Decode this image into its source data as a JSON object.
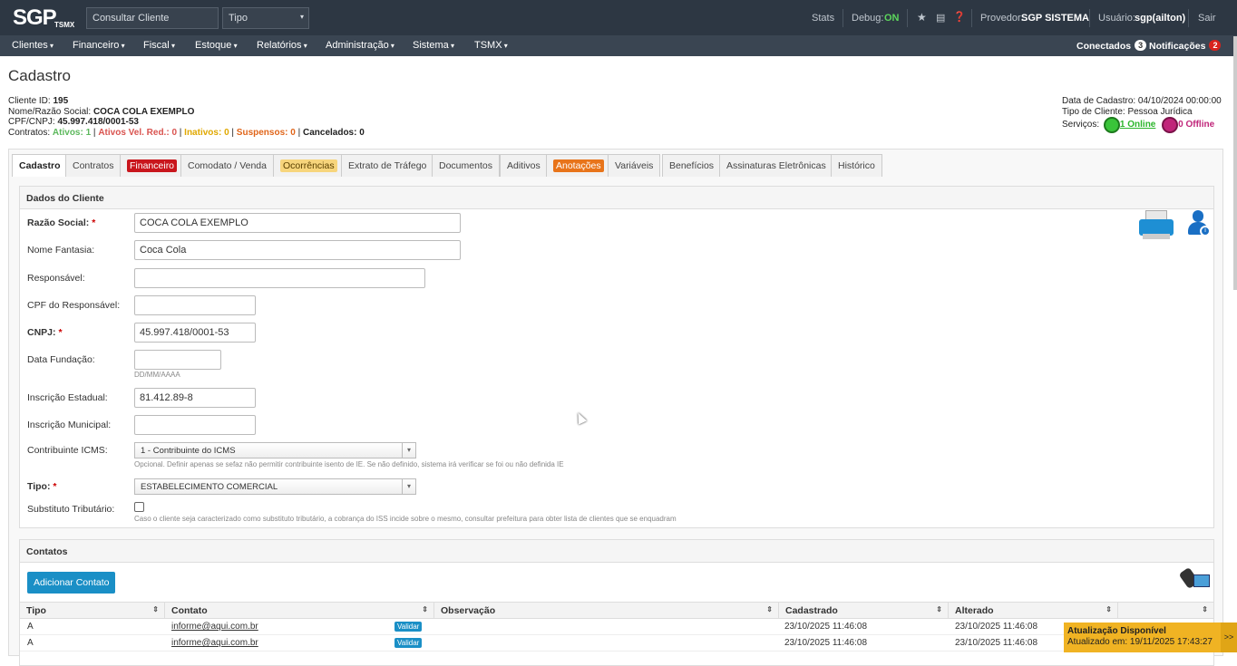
{
  "header": {
    "logo": "SGP",
    "logo_sub": "TSMX",
    "search_value": "Consultar Cliente",
    "type_select": "Tipo",
    "stats": "Stats",
    "debug_label": "Debug:",
    "debug_value": "ON",
    "provider_label": "Provedor:",
    "provider": "SGP SISTEMA",
    "user_label": "Usuário:",
    "user": "sgp(ailton)",
    "logout": "Sair"
  },
  "menu": [
    "Clientes",
    "Financeiro",
    "Fiscal",
    "Estoque",
    "Relatórios",
    "Administração",
    "Sistema",
    "TSMX"
  ],
  "connected": {
    "label": "Conectados",
    "count": "3"
  },
  "notifications": {
    "label": "Notificações",
    "count": "2"
  },
  "page_title": "Cadastro",
  "client": {
    "id_label": "Cliente ID:",
    "id": "195",
    "name_label": "Nome/Razão Social:",
    "name": "COCA COLA EXEMPLO",
    "doc_label": "CPF/CNPJ:",
    "doc": "45.997.418/0001-53",
    "contracts_label": "Contratos:",
    "ativos": "Ativos: 1",
    "ativos_red": "Ativos Vel. Red.: 0",
    "inativos": "Inativos: 0",
    "suspensos": "Suspensos: 0",
    "cancelados": "Cancelados: 0"
  },
  "client_right": {
    "data_cadastro": "Data de Cadastro: 04/10/2024 00:00:00",
    "tipo_cliente": "Tipo de Cliente: Pessoa Jurídica",
    "servicos": "Serviços:",
    "online": "1 Online",
    "offline": "0 Offline"
  },
  "tabs": [
    "Cadastro",
    "Contratos",
    "Financeiro",
    "Comodato / Venda",
    "Ocorrências",
    "Extrato de Tráfego",
    "Documentos",
    "Aditivos",
    "Anotações",
    "Variáveis",
    "Benefícios",
    "Assinaturas Eletrônicas",
    "Histórico"
  ],
  "form": {
    "title": "Dados do Cliente",
    "razao_label": "Razão Social:",
    "razao": "COCA COLA EXEMPLO",
    "fantasia_label": "Nome Fantasia:",
    "fantasia": "Coca Cola",
    "responsavel_label": "Responsável:",
    "responsavel": "",
    "cpf_resp_label": "CPF do Responsável:",
    "cpf_resp": "",
    "cnpj_label": "CNPJ:",
    "cnpj": "45.997.418/0001-53",
    "fundacao_label": "Data Fundação:",
    "fundacao": "",
    "fundacao_hint": "DD/MM/AAAA",
    "ie_label": "Inscrição Estadual:",
    "ie": "81.412.89-8",
    "im_label": "Inscrição Municipal:",
    "im": "",
    "icms_label": "Contribuinte ICMS:",
    "icms": "1 - Contribuinte do ICMS",
    "icms_hint": "Opcional. Definir apenas se sefaz não permitir contribuinte isento de IE. Se não definido, sistema irá verificar se foi ou não definida IE",
    "tipo_label": "Tipo:",
    "tipo": "ESTABELECIMENTO COMERCIAL",
    "subst_label": "Substituto Tributário:",
    "subst_hint": "Caso o cliente seja caracterizado como substituto tributário, a cobrança do ISS incide sobre o mesmo, consultar prefeitura para obter lista de clientes que se enquadram"
  },
  "contacts": {
    "title": "Contatos",
    "add_button": "Adicionar Contato",
    "columns": [
      "Tipo",
      "Contato",
      "Observação",
      "Cadastrado",
      "Alterado"
    ],
    "rows": [
      {
        "tipo": "A",
        "contato": "informe@aqui.com.br",
        "tag": "Validar",
        "obs": "",
        "cadastrado": "23/10/2025 11:46:08",
        "alterado": "23/10/2025 11:46:08"
      },
      {
        "tipo": "A",
        "contato": "informe@aqui.com.br",
        "tag": "Validar",
        "obs": "",
        "cadastrado": "23/10/2025 11:46:08",
        "alterado": "23/10/2025 11:46:08"
      }
    ]
  },
  "toast": {
    "title": "Atualização Disponível",
    "subtitle": "Atualizado em: 19/11/2025 17:43:27",
    "arrow": ">>"
  }
}
